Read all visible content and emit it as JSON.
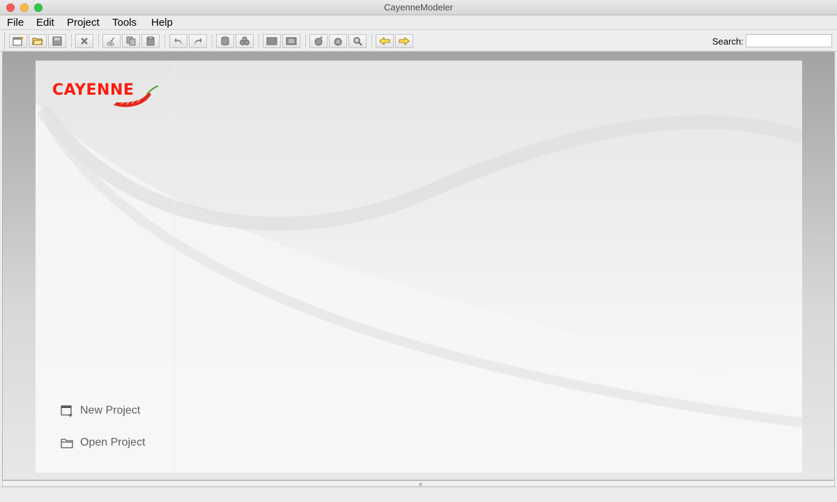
{
  "window": {
    "title": "CayenneModeler"
  },
  "menu": {
    "items": [
      "File",
      "Edit",
      "Project",
      "Tools",
      "Help"
    ]
  },
  "toolbar": {
    "buttons": [
      {
        "icon": "new-project-icon"
      },
      {
        "icon": "open-project-icon"
      },
      {
        "icon": "save-icon"
      },
      {
        "icon": "remove-icon"
      },
      {
        "icon": "cut-icon"
      },
      {
        "icon": "copy-icon"
      },
      {
        "icon": "paste-icon"
      },
      {
        "icon": "undo-icon"
      },
      {
        "icon": "redo-icon"
      },
      {
        "icon": "create-datamap-icon"
      },
      {
        "icon": "create-datanode-icon"
      },
      {
        "icon": "create-objentity-icon"
      },
      {
        "icon": "create-dbentity-icon"
      },
      {
        "icon": "create-procedure-icon"
      },
      {
        "icon": "create-query-icon"
      },
      {
        "icon": "find-icon"
      },
      {
        "icon": "navigate-back-icon"
      },
      {
        "icon": "navigate-forward-icon"
      }
    ],
    "search_label": "Search:",
    "search_value": ""
  },
  "welcome": {
    "logo_text": "CAYENNE",
    "actions": [
      {
        "label": "New Project",
        "icon": "new-project-icon"
      },
      {
        "label": "Open Project",
        "icon": "folder-icon"
      }
    ]
  },
  "colors": {
    "logo_red": "#ff1a0a",
    "pepper_green": "#4a9a2a"
  }
}
